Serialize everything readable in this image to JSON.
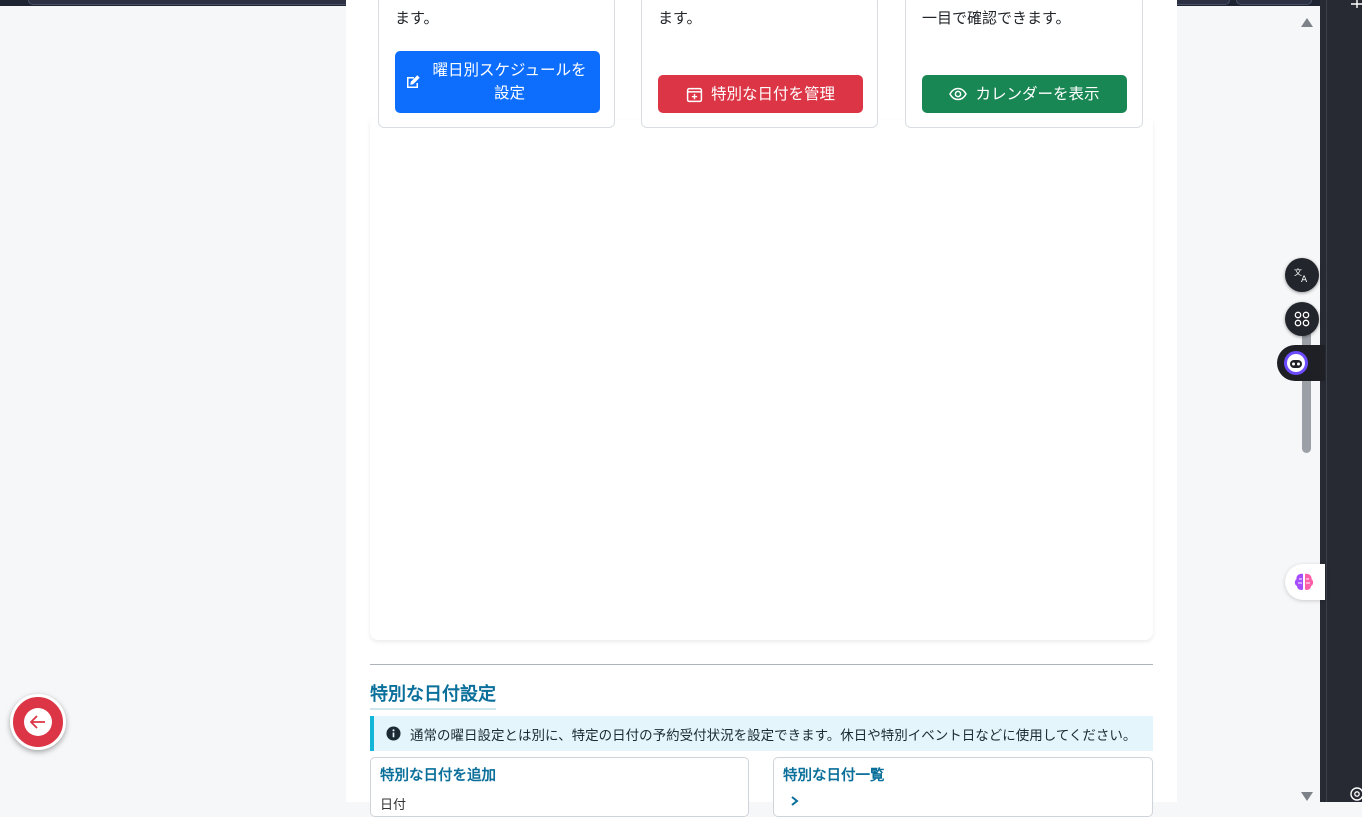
{
  "cards": [
    {
      "text": "ます。",
      "button_label": "曜日別スケジュールを設定",
      "icon": "edit-icon",
      "color": "#0d6efd"
    },
    {
      "text": "ます。",
      "button_label": "特別な日付を管理",
      "icon": "calendar-plus-icon",
      "color": "#dc3545"
    },
    {
      "text": "一目で確認できます。",
      "button_label": "カレンダーを表示",
      "icon": "eye-icon",
      "color": "#198754"
    }
  ],
  "special_dates": {
    "title": "特別な日付設定",
    "info_icon": "info-icon",
    "alert_text": "通常の曜日設定とは別に、特定の日付の予約受付状況を設定できます。休日や特別イベント日などに使用してください。",
    "add_panel": {
      "title": "特別な日付を追加",
      "date_label": "日付"
    },
    "list_panel": {
      "title": "特別な日付一覧"
    }
  },
  "colors": {
    "accent_title": "#0a6f9a",
    "alert_bg": "#e4f6fb",
    "alert_border": "#13b6d9",
    "back_button": "#dc3545"
  },
  "side_icons": [
    "translate-icon",
    "apps-icon",
    "assistant-robot-icon",
    "brain-icon"
  ],
  "back_button_icon": "arrow-left-icon"
}
